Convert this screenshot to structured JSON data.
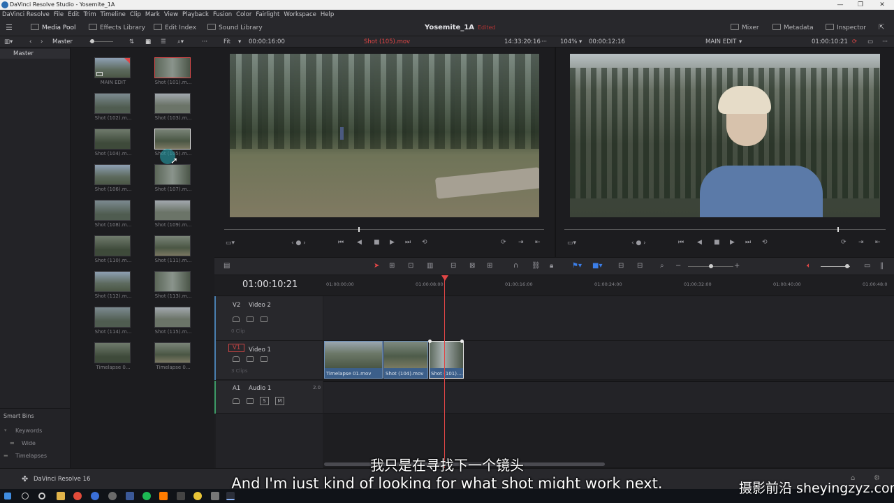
{
  "window": {
    "title": "DaVinci Resolve Studio - Yosemite_1A",
    "controls": [
      "—",
      "❐",
      "✕"
    ]
  },
  "menu": [
    "DaVinci Resolve",
    "File",
    "Edit",
    "Trim",
    "Timeline",
    "Clip",
    "Mark",
    "View",
    "Playback",
    "Fusion",
    "Color",
    "Fairlight",
    "Workspace",
    "Help"
  ],
  "toolbar": {
    "media_pool": "Media Pool",
    "effects_library": "Effects Library",
    "edit_index": "Edit Index",
    "sound_library": "Sound Library",
    "project_name": "Yosemite_1A",
    "project_status": "Edited",
    "mixer": "Mixer",
    "metadata": "Metadata",
    "inspector": "Inspector"
  },
  "bin_bar": {
    "path": "Master"
  },
  "source_viewer": {
    "zoom": "Fit",
    "duration": "00:00:16:00",
    "clip_name": "Shot (105).mov",
    "timecode": "14:33:20:16",
    "playhead_fraction": 0.42
  },
  "timeline_viewer": {
    "zoom": "104%",
    "duration": "00:00:12:16",
    "timeline_name": "MAIN EDIT",
    "timecode": "01:00:10:21",
    "playhead_fraction": 0.85
  },
  "left_panel": {
    "master": "Master",
    "smart_bins": "Smart Bins",
    "keywords": "Keywords",
    "wide": "Wide",
    "timelapses": "Timelapses",
    "app_name": "DaVinci Resolve 16"
  },
  "media_pool": [
    {
      "label": "MAIN EDIT",
      "state": "timeline"
    },
    {
      "label": "Shot (101).m...",
      "state": "selected"
    },
    {
      "label": "Shot (102).m...",
      "state": ""
    },
    {
      "label": "Shot (103).m...",
      "state": ""
    },
    {
      "label": "Shot (104).m...",
      "state": ""
    },
    {
      "label": "Shot (105).m...",
      "state": "hover"
    },
    {
      "label": "Shot (106).m...",
      "state": ""
    },
    {
      "label": "Shot (107).m...",
      "state": ""
    },
    {
      "label": "Shot (108).m...",
      "state": ""
    },
    {
      "label": "Shot (109).m...",
      "state": ""
    },
    {
      "label": "Shot (110).m...",
      "state": ""
    },
    {
      "label": "Shot (111).m...",
      "state": ""
    },
    {
      "label": "Shot (112).m...",
      "state": ""
    },
    {
      "label": "Shot (113).m...",
      "state": ""
    },
    {
      "label": "Shot (114).m...",
      "state": ""
    },
    {
      "label": "Shot (115).m...",
      "state": ""
    },
    {
      "label": "Timelapse 0...",
      "state": ""
    },
    {
      "label": "Timelapse 0...",
      "state": ""
    }
  ],
  "timeline": {
    "timecode": "01:00:10:21",
    "ruler": [
      "01:00:00:00",
      "01:00:08:00",
      "01:00:16:00",
      "01:00:24:00",
      "01:00:32:00",
      "01:00:40:00",
      "01:00:48:0"
    ],
    "tracks": {
      "v2": {
        "id": "V2",
        "name": "Video 2",
        "count": "0 Clip"
      },
      "v1": {
        "id": "V1",
        "name": "Video 1",
        "count": "3 Clips"
      },
      "a1": {
        "id": "A1",
        "name": "Audio 1",
        "channels": "2.0",
        "solo": "S",
        "mute": "M"
      }
    },
    "clips": [
      "Timelapse 01.mov",
      "Shot (104).mov",
      "Shot (101)...."
    ]
  },
  "subtitles": {
    "cn": "我只是在寻找下一个镜头",
    "en": "And I'm just kind of looking for what shot might work next.",
    "watermark": "摄影前沿 sheyingzyz.com"
  },
  "colors": {
    "accent_red": "#e04646",
    "clip_blue": "#3c5f8a",
    "panel_bg": "#28282c"
  }
}
